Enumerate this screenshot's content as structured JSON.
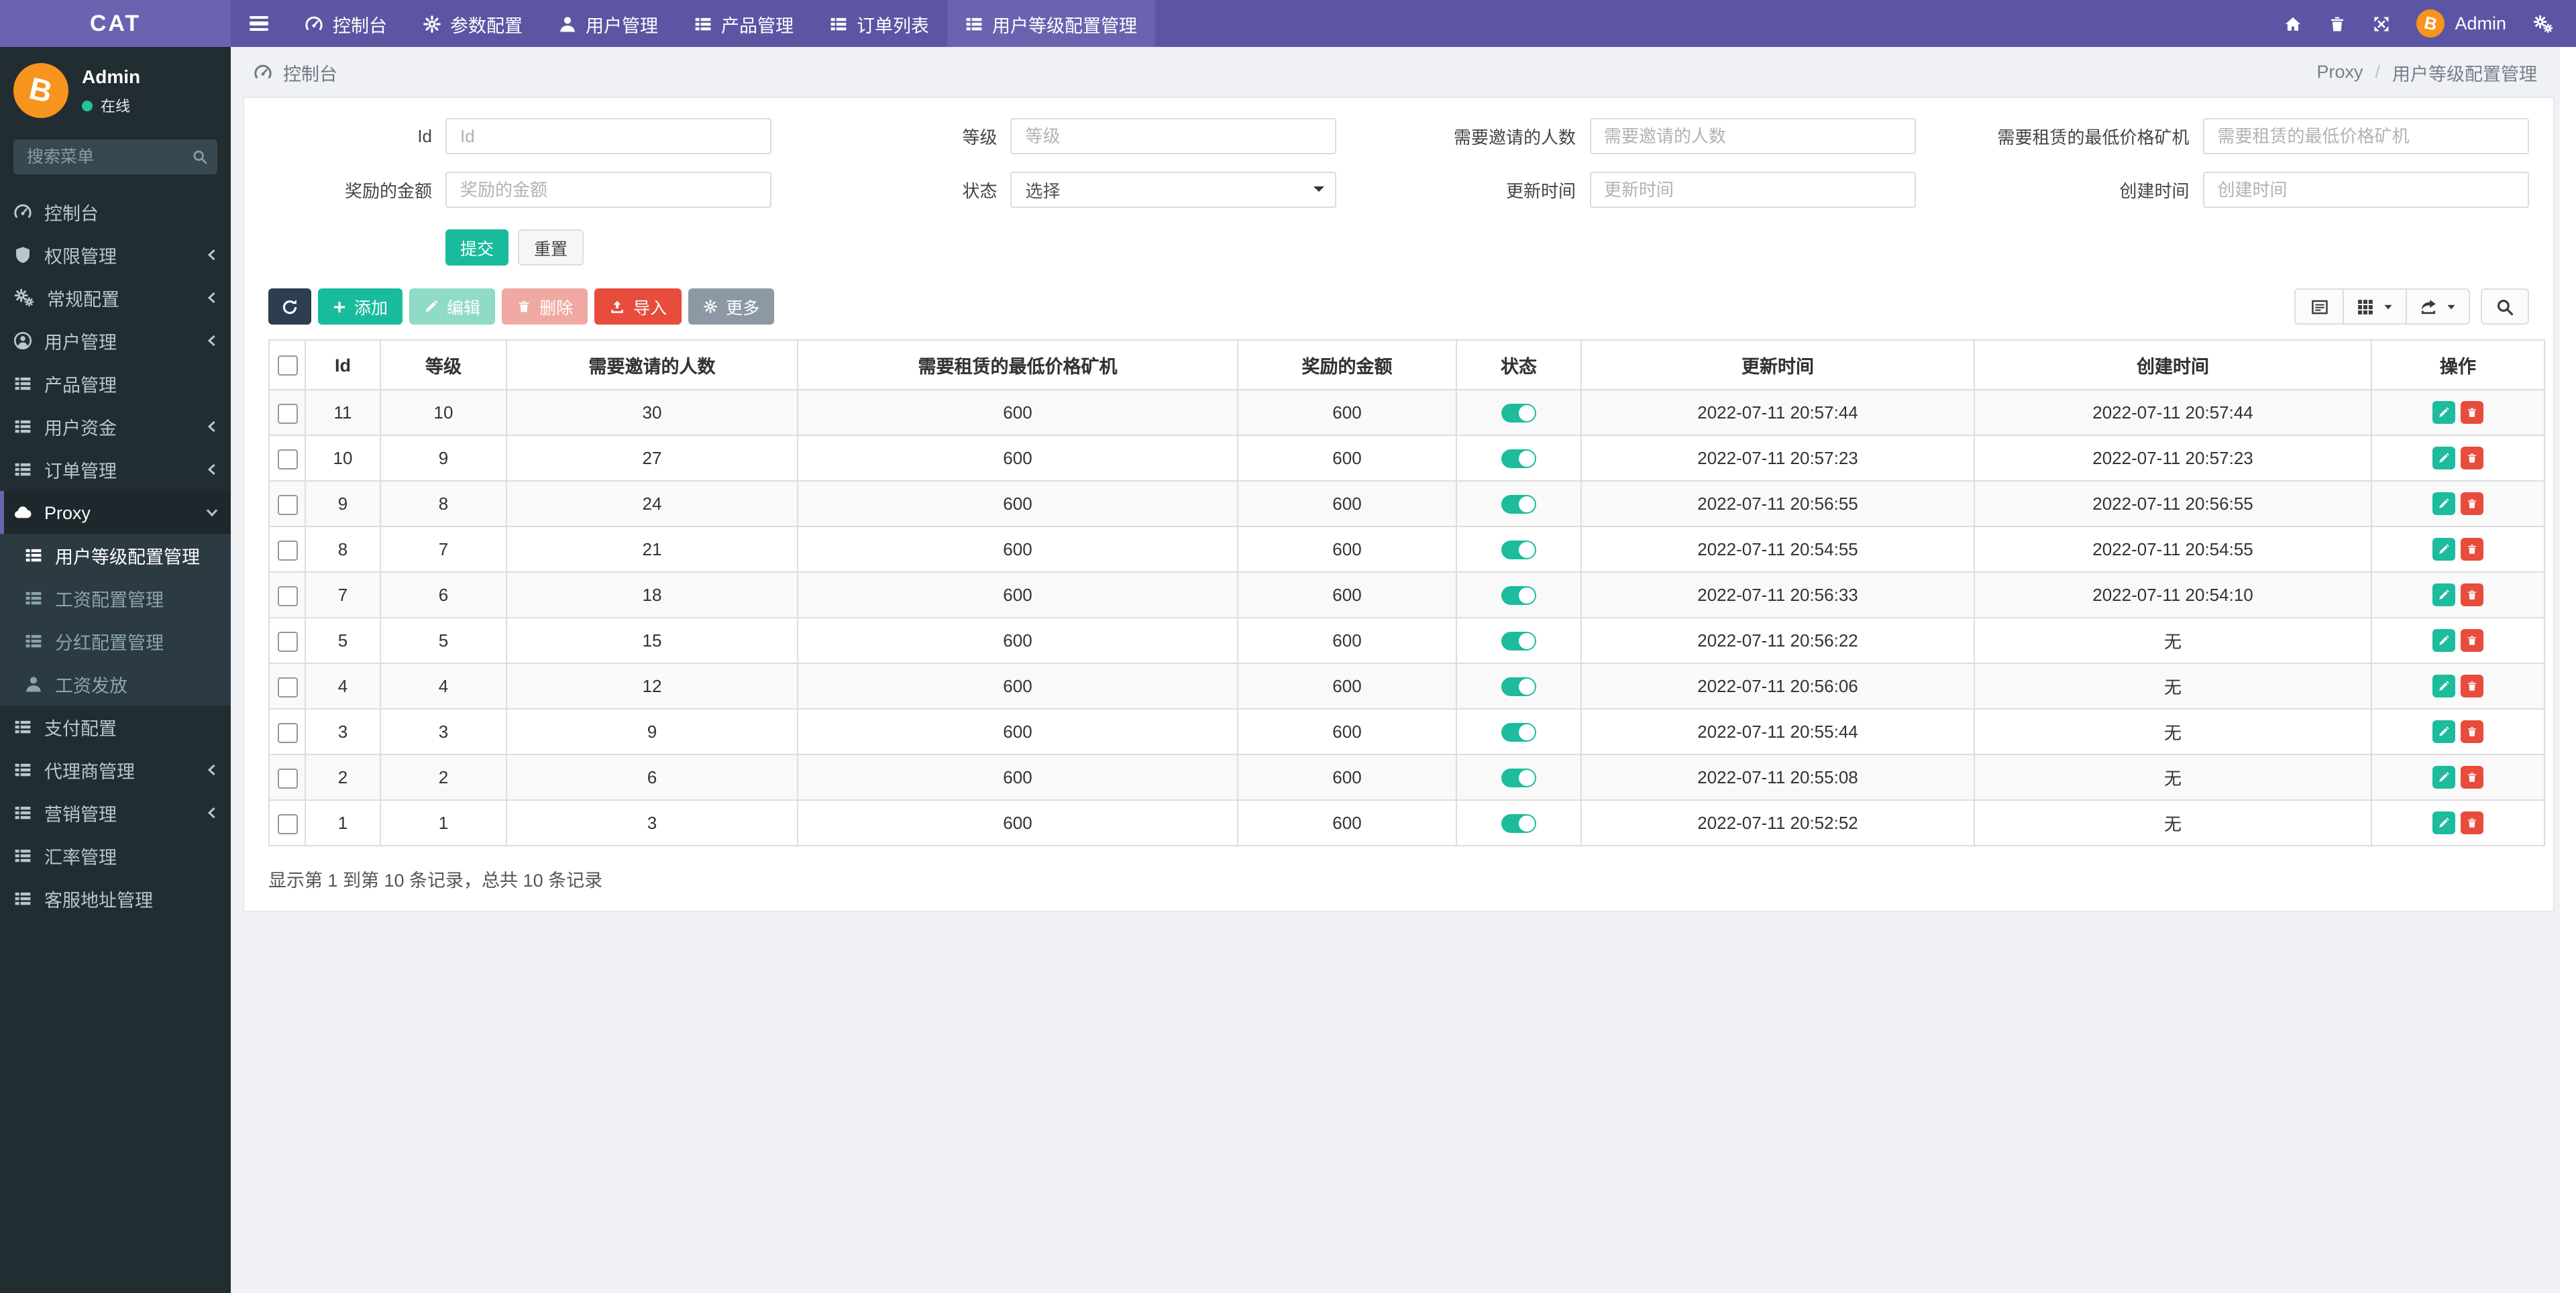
{
  "navbar": {
    "brand": "CAT",
    "items": [
      {
        "label": "控制台"
      },
      {
        "label": "参数配置"
      },
      {
        "label": "用户管理"
      },
      {
        "label": "产品管理"
      },
      {
        "label": "订单列表"
      },
      {
        "label": "用户等级配置管理"
      }
    ],
    "user_name": "Admin"
  },
  "sidebar": {
    "user": {
      "name": "Admin",
      "status": "在线"
    },
    "search_placeholder": "搜索菜单",
    "items": [
      {
        "label": "控制台"
      },
      {
        "label": "权限管理"
      },
      {
        "label": "常规配置"
      },
      {
        "label": "用户管理"
      },
      {
        "label": "产品管理"
      },
      {
        "label": "用户资金"
      },
      {
        "label": "订单管理"
      },
      {
        "label": "Proxy"
      },
      {
        "label": "用户等级配置管理"
      },
      {
        "label": "工资配置管理"
      },
      {
        "label": "分红配置管理"
      },
      {
        "label": "工资发放"
      },
      {
        "label": "支付配置"
      },
      {
        "label": "代理商管理"
      },
      {
        "label": "营销管理"
      },
      {
        "label": "汇率管理"
      },
      {
        "label": "客服地址管理"
      }
    ]
  },
  "breadcrumb": {
    "left": "控制台",
    "section": "Proxy",
    "separator": "/",
    "page": "用户等级配置管理"
  },
  "filters": {
    "id": {
      "label": "Id",
      "placeholder": "Id"
    },
    "level": {
      "label": "等级",
      "placeholder": "等级"
    },
    "invites": {
      "label": "需要邀请的人数",
      "placeholder": "需要邀请的人数"
    },
    "min_price": {
      "label": "需要租赁的最低价格矿机",
      "placeholder": "需要租赁的最低价格矿机"
    },
    "reward": {
      "label": "奖励的金额",
      "placeholder": "奖励的金额"
    },
    "status": {
      "label": "状态",
      "value": "选择"
    },
    "updated": {
      "label": "更新时间",
      "placeholder": "更新时间"
    },
    "created": {
      "label": "创建时间",
      "placeholder": "创建时间"
    },
    "submit_label": "提交",
    "reset_label": "重置"
  },
  "toolbar": {
    "add_label": "添加",
    "edit_label": "编辑",
    "delete_label": "删除",
    "import_label": "导入",
    "more_label": "更多"
  },
  "table": {
    "headers": [
      "Id",
      "等级",
      "需要邀请的人数",
      "需要租赁的最低价格矿机",
      "奖励的金额",
      "状态",
      "更新时间",
      "创建时间",
      "操作"
    ],
    "rows": [
      {
        "id": "11",
        "level": "10",
        "invites": "30",
        "price": "600",
        "reward": "600",
        "status": "on",
        "updated": "2022-07-11 20:57:44",
        "created": "2022-07-11 20:57:44"
      },
      {
        "id": "10",
        "level": "9",
        "invites": "27",
        "price": "600",
        "reward": "600",
        "status": "on",
        "updated": "2022-07-11 20:57:23",
        "created": "2022-07-11 20:57:23"
      },
      {
        "id": "9",
        "level": "8",
        "invites": "24",
        "price": "600",
        "reward": "600",
        "status": "on",
        "updated": "2022-07-11 20:56:55",
        "created": "2022-07-11 20:56:55"
      },
      {
        "id": "8",
        "level": "7",
        "invites": "21",
        "price": "600",
        "reward": "600",
        "status": "on",
        "updated": "2022-07-11 20:54:55",
        "created": "2022-07-11 20:54:55"
      },
      {
        "id": "7",
        "level": "6",
        "invites": "18",
        "price": "600",
        "reward": "600",
        "status": "on",
        "updated": "2022-07-11 20:56:33",
        "created": "2022-07-11 20:54:10"
      },
      {
        "id": "5",
        "level": "5",
        "invites": "15",
        "price": "600",
        "reward": "600",
        "status": "on",
        "updated": "2022-07-11 20:56:22",
        "created": "无"
      },
      {
        "id": "4",
        "level": "4",
        "invites": "12",
        "price": "600",
        "reward": "600",
        "status": "on",
        "updated": "2022-07-11 20:56:06",
        "created": "无"
      },
      {
        "id": "3",
        "level": "3",
        "invites": "9",
        "price": "600",
        "reward": "600",
        "status": "on",
        "updated": "2022-07-11 20:55:44",
        "created": "无"
      },
      {
        "id": "2",
        "level": "2",
        "invites": "6",
        "price": "600",
        "reward": "600",
        "status": "on",
        "updated": "2022-07-11 20:55:08",
        "created": "无"
      },
      {
        "id": "1",
        "level": "1",
        "invites": "3",
        "price": "600",
        "reward": "600",
        "status": "on",
        "updated": "2022-07-11 20:52:52",
        "created": "无"
      }
    ],
    "summary": "显示第 1 到第 10 条记录，总共 10 条记录"
  },
  "colors": {
    "navbar": "#5C55A3",
    "navbar_light": "#6A63B0",
    "sidebar": "#222D32",
    "submenu": "#2C3B41",
    "teal": "#18BC9C",
    "red": "#E74C3C",
    "dark_button": "#2C3E50",
    "gray_button": "#8C99A5",
    "avatar_orange": "#F7941E",
    "content_bg": "#EFF1F5"
  }
}
